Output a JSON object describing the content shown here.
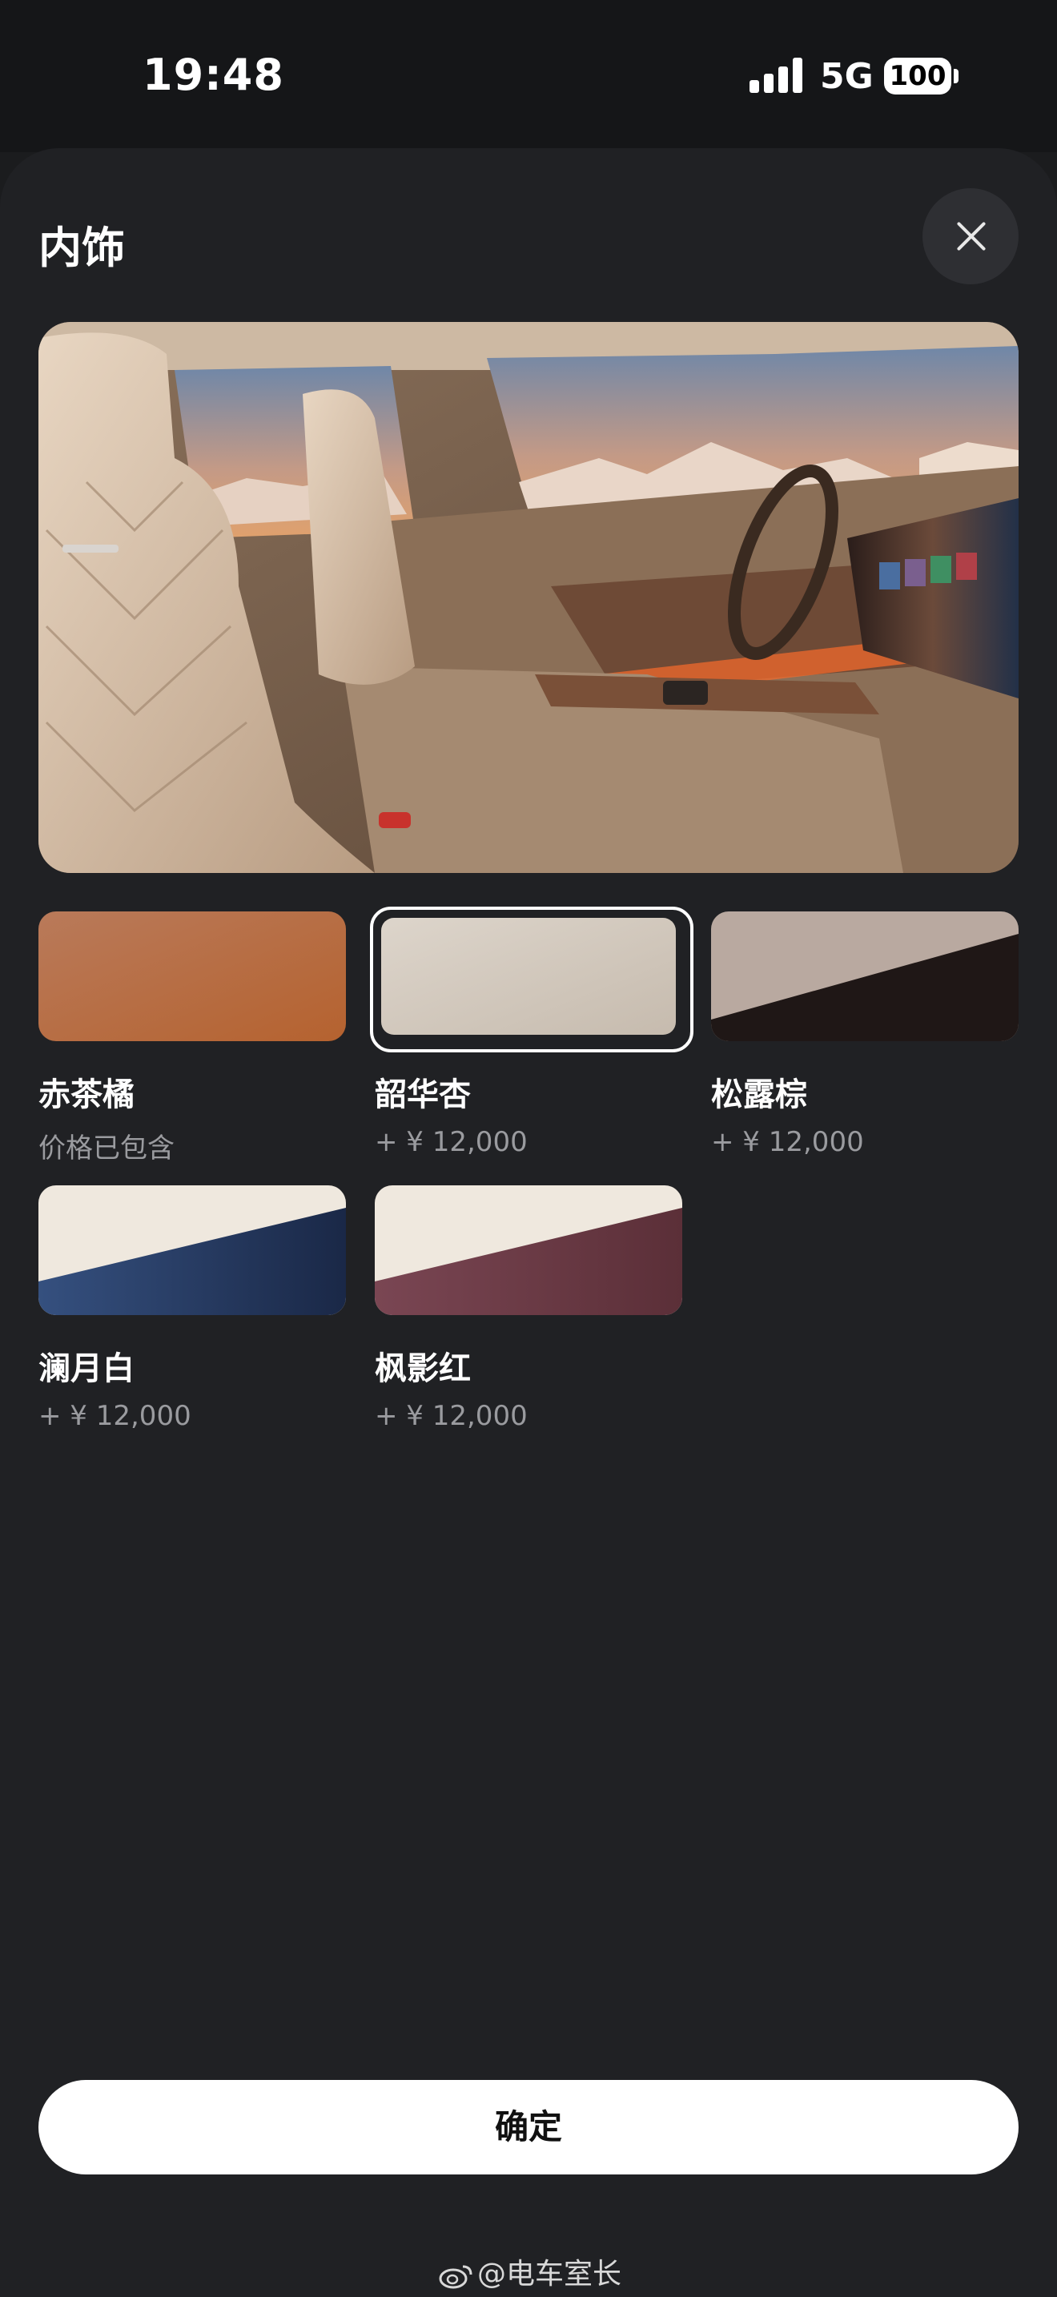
{
  "status_bar": {
    "time": "19:48",
    "network": "5G",
    "battery": "100"
  },
  "sheet": {
    "title": "内饰"
  },
  "options": [
    {
      "name": "赤茶橘",
      "price": "价格已包含",
      "selected": false,
      "colors": [
        "#b97a5a",
        "#b5622f"
      ]
    },
    {
      "name": "韶华杏",
      "price": "+ ¥ 12,000",
      "selected": true,
      "colors": [
        "#ddd5cb",
        "#c6bbae"
      ]
    },
    {
      "name": "松露棕",
      "price": "+ ¥ 12,000",
      "selected": false,
      "colors": [
        "#b9a9a0",
        "#1f1716"
      ]
    },
    {
      "name": "澜月白",
      "price": "+ ¥ 12,000",
      "selected": false,
      "colors": [
        "#efe8de",
        "#1f2f52"
      ]
    },
    {
      "name": "枫影红",
      "price": "+ ¥ 12,000",
      "selected": false,
      "colors": [
        "#efe8de",
        "#6b3a45"
      ]
    }
  ],
  "confirm_label": "确定",
  "watermark": "@电车室长"
}
